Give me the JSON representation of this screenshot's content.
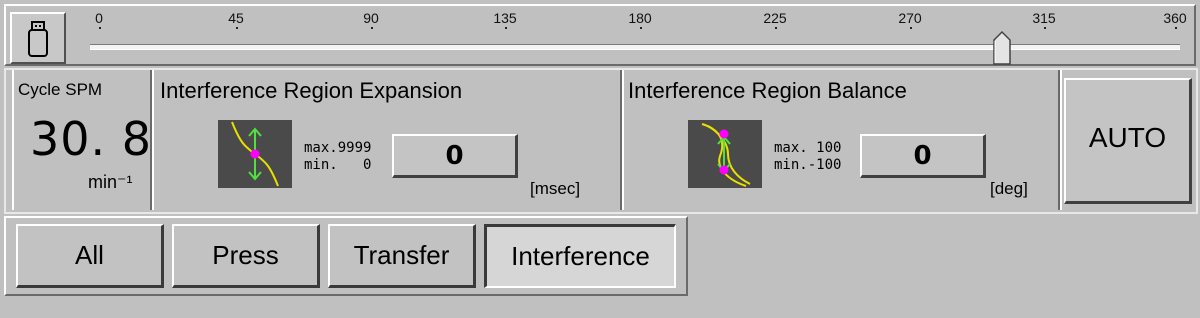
{
  "slider": {
    "ticks": [
      "0",
      "45",
      "90",
      "135",
      "180",
      "225",
      "270",
      "315",
      "360"
    ],
    "current_angle_deg": 302
  },
  "cycle_spm": {
    "title": "Cycle SPM",
    "value": "30. 8",
    "unit": "min⁻¹"
  },
  "expansion": {
    "title": "Interference Region Expansion",
    "limits": "max.9999\nmin.   0",
    "value": "0",
    "unit": "[msec]",
    "icon": "expansion-curve-icon"
  },
  "balance": {
    "title": "Interference Region Balance",
    "limits": "max. 100\nmin.-100",
    "value": "0",
    "unit": "[deg]",
    "icon": "balance-curve-icon"
  },
  "auto_button": {
    "label": "AUTO"
  },
  "tabs": [
    {
      "label": "All",
      "active": false
    },
    {
      "label": "Press",
      "active": false
    },
    {
      "label": "Transfer",
      "active": false
    },
    {
      "label": "Interference",
      "active": true
    }
  ],
  "colors": {
    "panel_bg": "#c0c0c0",
    "icon_bg": "#4a4a4a",
    "curve_yellow": "#e8e000",
    "arrow_green": "#50e040",
    "marker_magenta": "#ff00ff"
  }
}
